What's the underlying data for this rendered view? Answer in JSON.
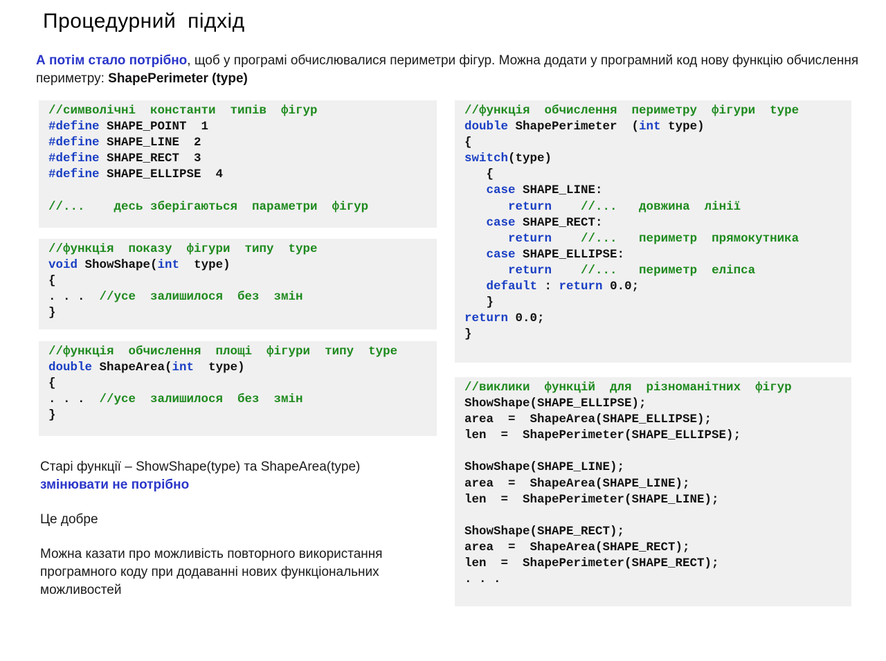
{
  "title": "Процедурний  підхід",
  "intro": {
    "highlight": "А потім стало потрібно",
    "text": ", щоб у програмі обчислювалися периметри фігур. Можна додати у програмний код нову функцію обчислення периметру:  ",
    "function_name": "ShapePerimeter (type)"
  },
  "code_blocks": [
    {
      "id": "constants",
      "lines": [
        [
          [
            "comment",
            "//символічні  константи  типів  фігур"
          ]
        ],
        [
          [
            "kw",
            "#define"
          ],
          [
            "plain",
            " SHAPE_POINT  1"
          ]
        ],
        [
          [
            "kw",
            "#define"
          ],
          [
            "plain",
            " SHAPE_LINE  2"
          ]
        ],
        [
          [
            "kw",
            "#define"
          ],
          [
            "plain",
            " SHAPE_RECT  3"
          ]
        ],
        [
          [
            "kw",
            "#define"
          ],
          [
            "plain",
            " SHAPE_ELLIPSE  4"
          ]
        ],
        [
          [
            "plain",
            ""
          ]
        ],
        [
          [
            "comment",
            "//...    десь зберігаються  параметри  фігур"
          ]
        ]
      ]
    },
    {
      "id": "show-shape",
      "lines": [
        [
          [
            "comment",
            "//функція  показу  фігури  типу  type"
          ]
        ],
        [
          [
            "kw",
            "void"
          ],
          [
            "plain",
            " ShowShape("
          ],
          [
            "kw",
            "int"
          ],
          [
            "plain",
            "  type)"
          ]
        ],
        [
          [
            "plain",
            "{"
          ]
        ],
        [
          [
            "plain",
            ". . .  "
          ],
          [
            "comment",
            "//усе  залишилося  без  змін"
          ]
        ],
        [
          [
            "plain",
            "}"
          ]
        ]
      ]
    },
    {
      "id": "shape-area",
      "lines": [
        [
          [
            "comment",
            "//функція  обчислення  площі  фігури  типу  type"
          ]
        ],
        [
          [
            "kw",
            "double"
          ],
          [
            "plain",
            " ShapeArea("
          ],
          [
            "kw",
            "int"
          ],
          [
            "plain",
            "  type)"
          ]
        ],
        [
          [
            "plain",
            "{"
          ]
        ],
        [
          [
            "plain",
            ". . .  "
          ],
          [
            "comment",
            "//усе  залишилося  без  змін"
          ]
        ],
        [
          [
            "plain",
            "}"
          ]
        ]
      ]
    },
    {
      "id": "shape-perimeter",
      "lines": [
        [
          [
            "comment",
            "//функція  обчислення  периметру  фігури  type"
          ]
        ],
        [
          [
            "kw",
            "double"
          ],
          [
            "plain",
            " ShapePerimeter  ("
          ],
          [
            "kw",
            "int"
          ],
          [
            "plain",
            " type)"
          ]
        ],
        [
          [
            "plain",
            "{"
          ]
        ],
        [
          [
            "kw",
            "switch"
          ],
          [
            "plain",
            "(type)"
          ]
        ],
        [
          [
            "plain",
            "   {"
          ]
        ],
        [
          [
            "kw",
            "   case"
          ],
          [
            "plain",
            " SHAPE_LINE:"
          ]
        ],
        [
          [
            "kw",
            "      return"
          ],
          [
            "plain",
            "    "
          ],
          [
            "comment",
            "//...   довжина  лінії"
          ]
        ],
        [
          [
            "kw",
            "   case"
          ],
          [
            "plain",
            " SHAPE_RECT:"
          ]
        ],
        [
          [
            "kw",
            "      return"
          ],
          [
            "plain",
            "    "
          ],
          [
            "comment",
            "//...   периметр  прямокутника"
          ]
        ],
        [
          [
            "kw",
            "   case"
          ],
          [
            "plain",
            " SHAPE_ELLIPSE:"
          ]
        ],
        [
          [
            "kw",
            "      return"
          ],
          [
            "plain",
            "    "
          ],
          [
            "comment",
            "//...   периметр  еліпса"
          ]
        ],
        [
          [
            "kw",
            "   default"
          ],
          [
            "plain",
            " : "
          ],
          [
            "kw",
            "return"
          ],
          [
            "plain",
            " 0.0;"
          ]
        ],
        [
          [
            "plain",
            "   }"
          ]
        ],
        [
          [
            "kw",
            "return"
          ],
          [
            "plain",
            " 0.0;"
          ]
        ],
        [
          [
            "plain",
            "}"
          ]
        ]
      ]
    },
    {
      "id": "calls",
      "lines": [
        [
          [
            "comment",
            "//виклики  функцій  для  різноманітних  фігур"
          ]
        ],
        [
          [
            "plain",
            "ShowShape(SHAPE_ELLIPSE);"
          ]
        ],
        [
          [
            "plain",
            "area  =  ShapeArea(SHAPE_ELLIPSE);"
          ]
        ],
        [
          [
            "plain",
            "len  =  ShapePerimeter(SHAPE_ELLIPSE);"
          ]
        ],
        [
          [
            "plain",
            ""
          ]
        ],
        [
          [
            "plain",
            "ShowShape(SHAPE_LINE);"
          ]
        ],
        [
          [
            "plain",
            "area  =  ShapeArea(SHAPE_LINE);"
          ]
        ],
        [
          [
            "plain",
            "len  =  ShapePerimeter(SHAPE_LINE);"
          ]
        ],
        [
          [
            "plain",
            ""
          ]
        ],
        [
          [
            "plain",
            "ShowShape(SHAPE_RECT);"
          ]
        ],
        [
          [
            "plain",
            "area  =  ShapeArea(SHAPE_RECT);"
          ]
        ],
        [
          [
            "plain",
            "len  =  ShapePerimeter(SHAPE_RECT);"
          ]
        ],
        [
          [
            "plain",
            ". . ."
          ]
        ]
      ]
    }
  ],
  "notes": {
    "p1_text": "Старі функції – ShowShape(type) та ShapeArea(type)",
    "p1_highlight": "змінювати не потрібно",
    "p2": "Це добре",
    "p3": "Можна казати про можливість повторного використання програмного коду при додаванні нових функціональних можливостей"
  },
  "colors": {
    "keyword": "#1a3fc4",
    "comment": "#1e8a1e",
    "highlight": "#2a36c9",
    "code_background": "#f0f0f0"
  }
}
